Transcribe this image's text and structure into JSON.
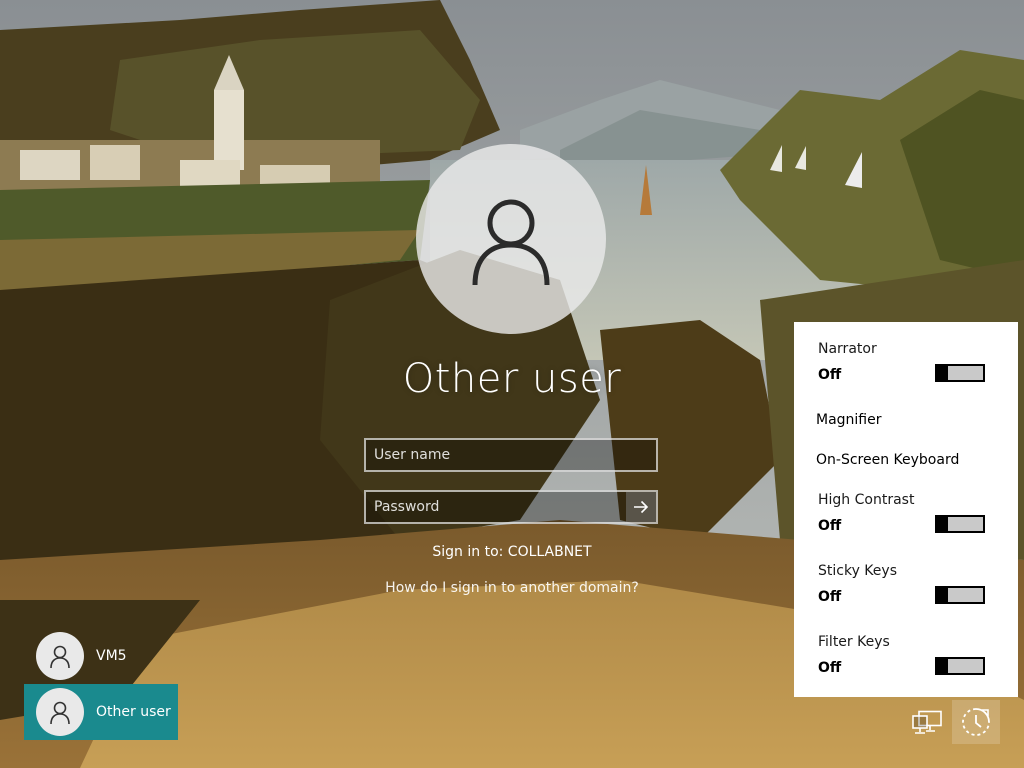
{
  "login": {
    "title": "Other user",
    "username_placeholder": "User name",
    "password_placeholder": "Password",
    "sign_in_to": "Sign in to: COLLABNET",
    "domain_help": "How do I sign in to another domain?"
  },
  "users": [
    {
      "label": "VM5"
    },
    {
      "label": "Other user"
    }
  ],
  "ease_of_access": {
    "narrator": {
      "title": "Narrator",
      "state": "Off"
    },
    "magnifier": {
      "title": "Magnifier"
    },
    "osk": {
      "title": "On-Screen Keyboard"
    },
    "high_contrast": {
      "title": "High Contrast",
      "state": "Off"
    },
    "sticky_keys": {
      "title": "Sticky Keys",
      "state": "Off"
    },
    "filter_keys": {
      "title": "Filter Keys",
      "state": "Off"
    }
  },
  "icons": {
    "avatar": "user-silhouette-icon",
    "submit": "arrow-right-icon",
    "network": "network-icon",
    "ease": "ease-of-access-icon"
  },
  "colors": {
    "selected_tile": "#1a8a8e",
    "panel_bg": "#ffffff"
  }
}
